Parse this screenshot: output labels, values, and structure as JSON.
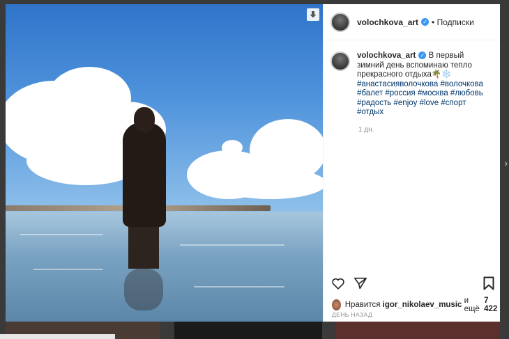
{
  "post": {
    "username": "volochkova_art",
    "follow_label": "• Подписки",
    "caption_intro": "В первый зимний день вспоминаю тепло прекрасного отдыха🌴❄️",
    "hashtags": [
      "#анастасияволочкова",
      "#волочкова",
      "#балет",
      "#россия",
      "#москва",
      "#любовь",
      "#радость",
      "#enjoy",
      "#love",
      "#спорт",
      "#отдых"
    ],
    "caption_time": "1 дн.",
    "likes_prefix": "Нравится",
    "liked_by": "igor_nikolaev_music",
    "likes_suffix": "и ещё",
    "likes_count": "7 422",
    "date": "ДЕНЬ НАЗАД"
  },
  "icons": {
    "download": "download-icon",
    "like": "heart-icon",
    "share": "share-icon",
    "save": "bookmark-icon",
    "verified": "verified-badge-icon",
    "next": "chevron-right-icon"
  },
  "colors": {
    "link": "#003569",
    "verified": "#3897f0",
    "text": "#262626",
    "muted": "#8e8e8e"
  }
}
